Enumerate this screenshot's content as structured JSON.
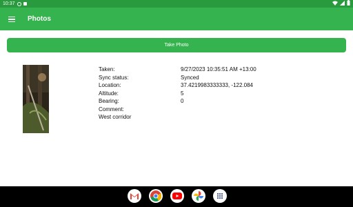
{
  "status_bar": {
    "time": "10:37"
  },
  "app_bar": {
    "title": "Photos"
  },
  "actions": {
    "take_photo_label": "Take Photo"
  },
  "photo": {
    "labels": [
      "Taken:",
      "Sync status:",
      "Location:",
      "Altitude:",
      "Bearing:",
      "Comment:",
      "West corridor"
    ],
    "values": [
      "9/27/2023 10:35:51 AM +13:00",
      "Synced",
      "37.4219983333333, -122.084",
      "5",
      "0",
      "",
      ""
    ]
  },
  "dock": {
    "apps": [
      "gmail-icon",
      "chrome-icon",
      "youtube-icon",
      "photos-icon",
      "app-drawer-icon"
    ]
  },
  "colors": {
    "status_bar": "#2a9a3f",
    "app_bar": "#35b34e",
    "button": "#35b34e",
    "nav_bar": "#000000"
  }
}
